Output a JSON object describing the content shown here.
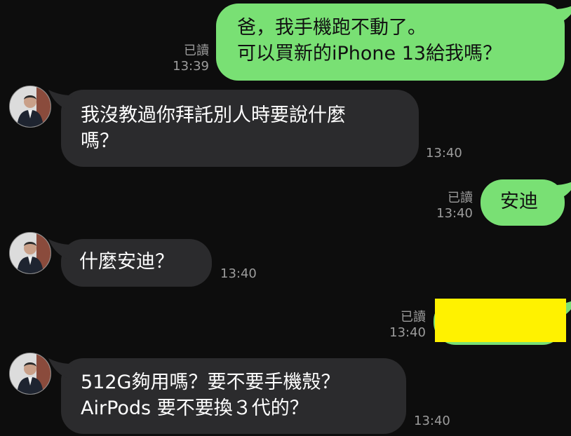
{
  "messages": [
    {
      "id": "m1",
      "side": "out",
      "lines": [
        "爸，我手機跑不動了。",
        "可以買新的iPhone 13給我嗎？"
      ],
      "read": "已讀",
      "time": "13:39"
    },
    {
      "id": "m2",
      "side": "in",
      "lines": [
        "我沒教過你拜託別人時要說什麼",
        "嗎？"
      ],
      "time": "13:40"
    },
    {
      "id": "m3",
      "side": "out",
      "lines": [
        "安迪"
      ],
      "read": "已讀",
      "time": "13:40"
    },
    {
      "id": "m4",
      "side": "in",
      "lines": [
        "什麼安迪？"
      ],
      "time": "13:40"
    },
    {
      "id": "m5",
      "side": "out",
      "lines": [],
      "redacted": true,
      "read": "已讀",
      "time": "13:40"
    },
    {
      "id": "m6",
      "side": "in",
      "lines": [
        "512G夠用嗎？要不要手機殼？",
        "AirPods 要不要換３代的？"
      ],
      "time": "13:40"
    }
  ],
  "colors": {
    "background": "#0d0d0d",
    "incoming_bubble": "#2b2b2d",
    "outgoing_bubble": "#79e074",
    "redaction": "#fff200",
    "meta_text": "#9c9c9c"
  },
  "icons": {
    "avatar": "contact-avatar-photo"
  }
}
